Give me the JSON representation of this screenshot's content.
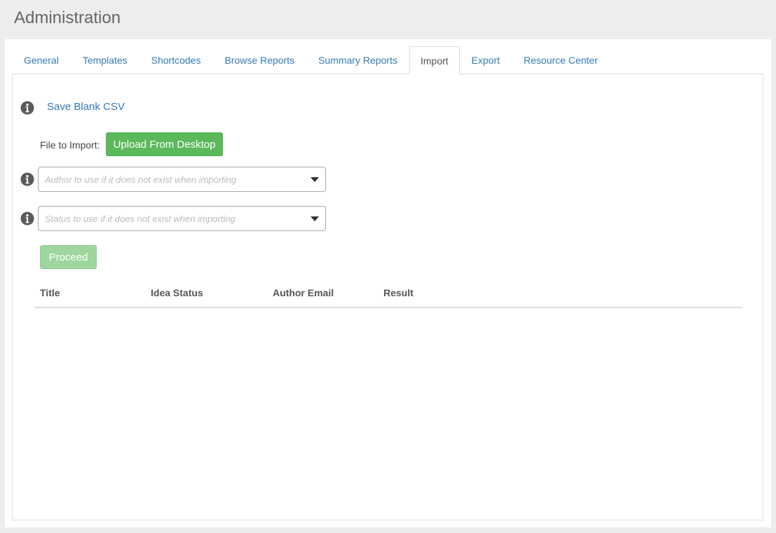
{
  "header": {
    "title": "Administration"
  },
  "tabs": [
    {
      "label": "General"
    },
    {
      "label": "Templates"
    },
    {
      "label": "Shortcodes"
    },
    {
      "label": "Browse Reports"
    },
    {
      "label": "Summary Reports"
    },
    {
      "label": "Import",
      "active": true
    },
    {
      "label": "Export"
    },
    {
      "label": "Resource Center"
    }
  ],
  "import": {
    "save_blank_csv": "Save Blank CSV",
    "file_label": "File to Import:",
    "upload_button": "Upload From Desktop",
    "author_select": {
      "placeholder": "Author to use if it does not exist when importing",
      "value": ""
    },
    "status_select": {
      "placeholder": "Status to use if it does not exist when importing",
      "value": ""
    },
    "proceed_button": "Proceed",
    "table": {
      "columns": [
        "Title",
        "Idea Status",
        "Author Email",
        "Result"
      ],
      "rows": []
    }
  },
  "icons": {
    "info": "info-circle-icon",
    "dropdown": "caret-down-icon"
  },
  "colors": {
    "link": "#337ab7",
    "success": "#5cb85c",
    "success_disabled": "#9ed69e",
    "icon": "#5a5a5a"
  }
}
